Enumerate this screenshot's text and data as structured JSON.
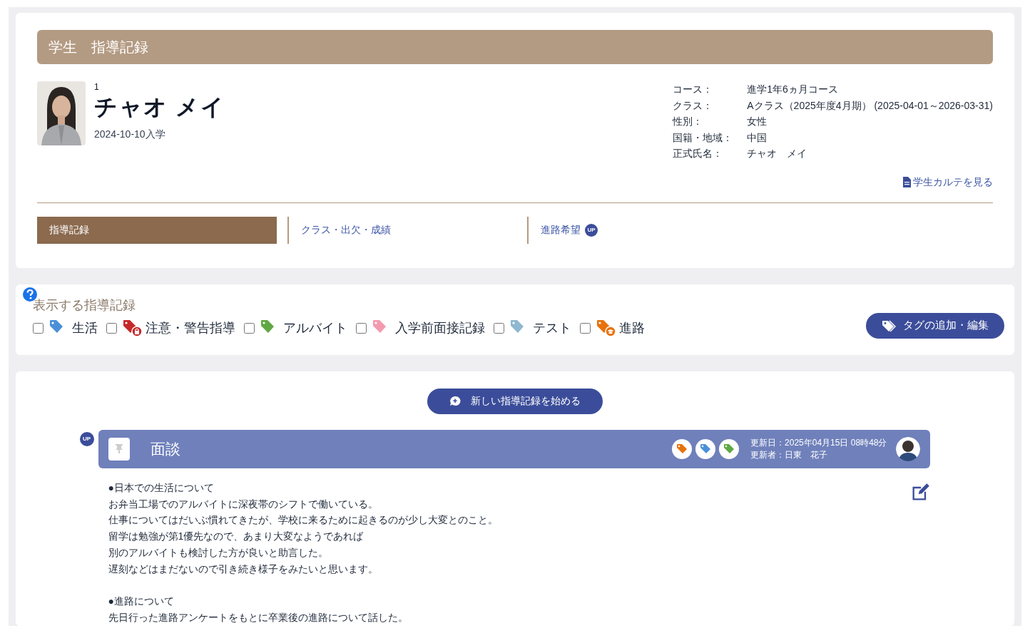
{
  "header": {
    "title": "学生　指導記録"
  },
  "student": {
    "number": "1",
    "name": "チャオ メイ",
    "enrolled": "2024-10-10入学"
  },
  "details": [
    {
      "label": "コース：",
      "value": "進学1年6ヵ月コース"
    },
    {
      "label": "クラス：",
      "value": "Aクラス（2025年度4月期） (2025-04-01～2026-03-31)"
    },
    {
      "label": "性別：",
      "value": "女性"
    },
    {
      "label": "国籍・地域：",
      "value": "中国"
    },
    {
      "label": "正式氏名：",
      "value": "チャオ　メイ"
    }
  ],
  "karte_link": "学生カルテを見る",
  "tabs": [
    {
      "label": "指導記録",
      "selected": true
    },
    {
      "label": "クラス・出欠・成績",
      "selected": false
    },
    {
      "label": "進路希望",
      "selected": false,
      "badge": "UP"
    }
  ],
  "filter": {
    "title": "表示する指導記録",
    "tags": [
      {
        "label": "生活",
        "checked": false,
        "color": "#4a90d9",
        "kind": "plain"
      },
      {
        "label": "注意・警告指導",
        "checked": false,
        "color": "#c62828",
        "kind": "lock"
      },
      {
        "label": "アルバイト",
        "checked": false,
        "color": "#5fa843",
        "kind": "plain"
      },
      {
        "label": "入学前面接記録",
        "checked": false,
        "color": "#f49ab0",
        "kind": "plain"
      },
      {
        "label": "テスト",
        "checked": false,
        "color": "#8fb8d0",
        "kind": "plain"
      },
      {
        "label": "進路",
        "checked": false,
        "color": "#e8710a",
        "kind": "cap"
      }
    ],
    "edit_button": "タグの追加・編集"
  },
  "new_record_button": "新しい指導記録を始める",
  "record": {
    "badge": "UP",
    "title": "面談",
    "tags": [
      {
        "color": "#e8710a"
      },
      {
        "color": "#4a90d9"
      },
      {
        "color": "#5fa843"
      }
    ],
    "updated": "更新日：2025年04月15日 08時48分",
    "updater": "更新者：日東　花子",
    "paragraphs": [
      [
        "●日本での生活について",
        "お弁当工場でのアルバイトに深夜帯のシフトで働いている。",
        "仕事についてはだいぶ慣れてきたが、学校に来るために起きるのが少し大変とのこと。",
        "留学は勉強が第1優先なので、あまり大変なようであれば",
        "別のアルバイトも検討した方が良いと助言した。",
        "遅刻などはまだないので引き続き様子をみたいと思います。"
      ],
      [
        "●進路について",
        "先日行った進路アンケートをもとに卒業後の進路について話した。"
      ]
    ]
  }
}
